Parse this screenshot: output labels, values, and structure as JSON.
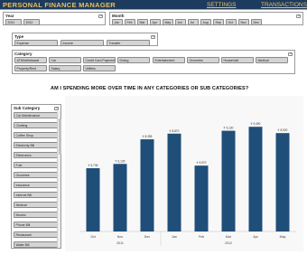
{
  "app": {
    "title": "PERSONAL FINANCE MANAGER",
    "nav": {
      "settings": "SETTINGS",
      "transactions": "TRANSACTIONS"
    }
  },
  "year_slicer": {
    "title": "Year",
    "items": [
      "2011",
      "2012"
    ]
  },
  "month_slicer": {
    "title": "Month",
    "items": [
      "Jan",
      "Feb",
      "Mar",
      "Apr",
      "May",
      "Jun",
      "Jul",
      "Aug",
      "Sep",
      "Oct",
      "Nov",
      "Dec"
    ]
  },
  "type_slicer": {
    "title": "Type",
    "items": [
      "Expense",
      "Income",
      "Transfer"
    ]
  },
  "category_slicer": {
    "title": "Category",
    "items": [
      "ATM/withdrawal",
      "Car",
      "Credit Card Payment",
      "Dining",
      "Entertainment",
      "Groceries",
      "Household",
      "Medical",
      "Property/Rent",
      "Salary",
      "Utilities"
    ]
  },
  "question": "AM I SPENDING MORE OVER TIME IN ANY CATEGORIES OR SUB CATEGORIES?",
  "subcategory_slicer": {
    "title": "Sub Category",
    "items": [
      "Car Maintenance",
      "Clothing",
      "Coffee Shop",
      "Electricity Bill",
      "Electronics",
      "Fuel",
      "Groceries",
      "Insurance",
      "Internet Bill",
      "Medical",
      "Movies",
      "Phone Bill",
      "Restaurant",
      "Water Bill"
    ]
  },
  "chart_data": {
    "type": "bar",
    "categories": [
      "Oct",
      "Nov",
      "Dec",
      "Jan",
      "Feb",
      "Mar",
      "Apr",
      "May"
    ],
    "values": [
      5735,
      6125,
      8355,
      8870,
      5970,
      9130,
      9490,
      8920
    ],
    "data_labels": [
      "₹ 5,735",
      "₹ 6,125",
      "₹ 8,355",
      "₹ 8,870",
      "₹ 5,970",
      "₹ 9,130",
      "₹ 9,490",
      "₹ 8,920"
    ],
    "group_labels": [
      {
        "label": "2011",
        "from": 0,
        "to": 2
      },
      {
        "label": "2012",
        "from": 3,
        "to": 7
      }
    ],
    "ylim": [
      0,
      10000
    ],
    "bar_color": "#1f4e79",
    "grid": false
  }
}
